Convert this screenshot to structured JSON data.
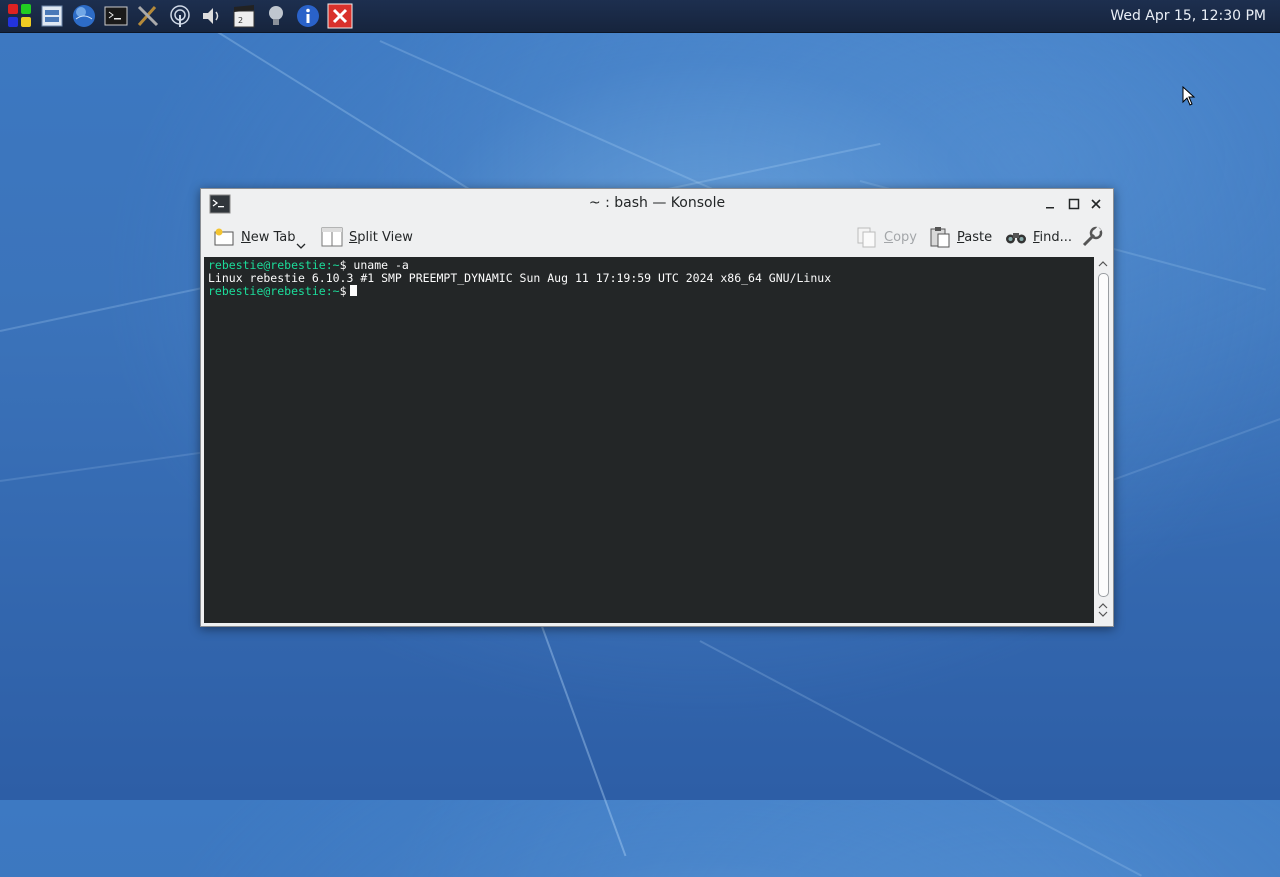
{
  "panel": {
    "launchers": [
      {
        "name": "kde-apps-menu-icon"
      },
      {
        "name": "file-manager-icon"
      },
      {
        "name": "web-browser-icon"
      },
      {
        "name": "terminal-icon"
      },
      {
        "name": "tools-icon"
      },
      {
        "name": "network-icon"
      },
      {
        "name": "volume-icon"
      },
      {
        "name": "video-editor-icon"
      },
      {
        "name": "bulb-icon"
      },
      {
        "name": "info-icon"
      },
      {
        "name": "close-session-icon"
      }
    ],
    "clock": "Wed Apr 15, 12:30 PM"
  },
  "window": {
    "title": "~ : bash — Konsole",
    "toolbar": {
      "new_tab_prefix": "N",
      "new_tab_rest": "ew Tab",
      "split_view_prefix": "S",
      "split_view_rest": "plit View",
      "copy_prefix": "C",
      "copy_rest": "opy",
      "paste_prefix": "P",
      "paste_rest": "aste",
      "find_prefix": "F",
      "find_rest": "ind..."
    },
    "terminal": {
      "lines": [
        {
          "prompt": "rebestie@rebestie",
          "path": ":~",
          "sym": "$ ",
          "cmd": "uname -a"
        },
        {
          "output": "Linux rebestie 6.10.3 #1 SMP PREEMPT_DYNAMIC Sun Aug 11 17:19:59 UTC 2024 x86_64 GNU/Linux"
        },
        {
          "prompt": "rebestie@rebestie",
          "path": ":~",
          "sym": "$",
          "cmd": ""
        }
      ]
    }
  },
  "colors": {
    "prompt": "#1cdc9a",
    "terminal_bg": "#232627",
    "panel_bg": "#1d2f4f"
  }
}
